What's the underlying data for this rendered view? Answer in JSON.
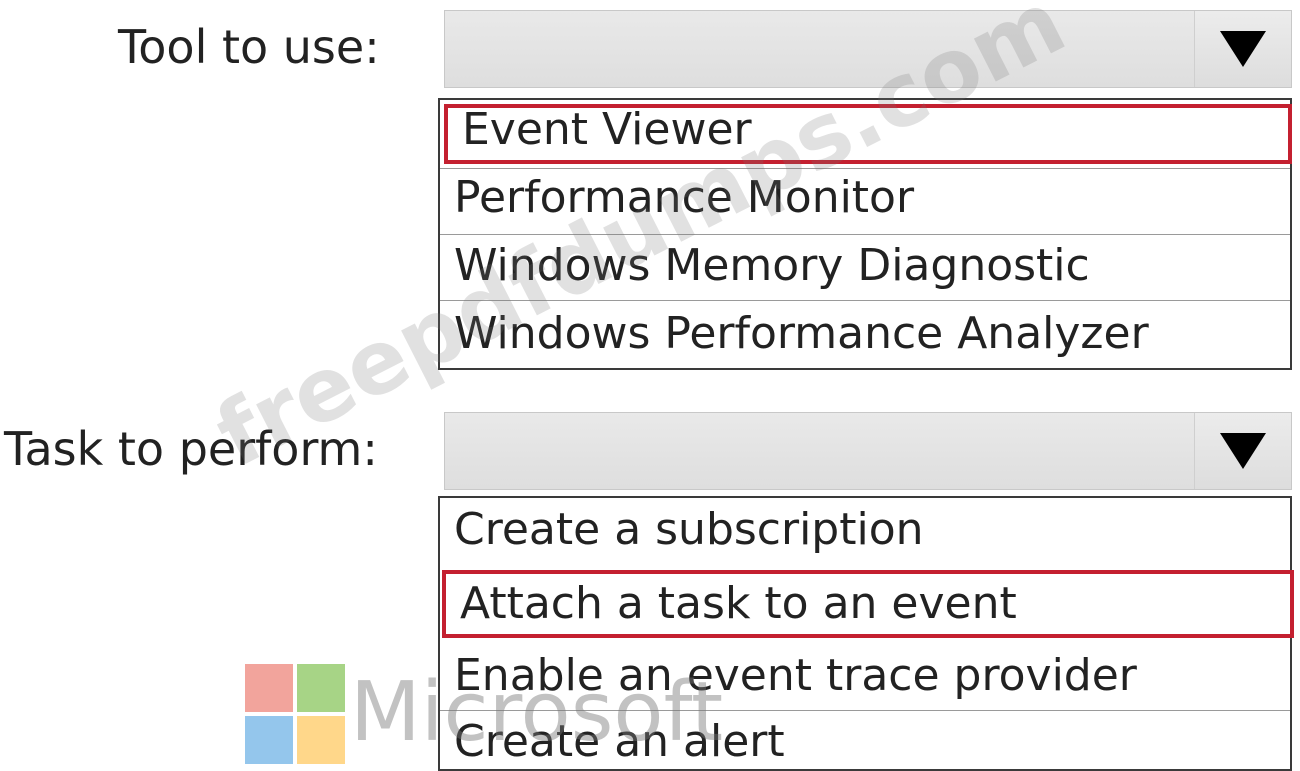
{
  "tool_section": {
    "label": "Tool to use:",
    "selected_value": "",
    "options": [
      {
        "label": "Event Viewer",
        "highlighted": true
      },
      {
        "label": "Performance Monitor",
        "highlighted": false
      },
      {
        "label": "Windows Memory Diagnostic",
        "highlighted": false
      },
      {
        "label": "Windows Performance Analyzer",
        "highlighted": false
      }
    ]
  },
  "task_section": {
    "label": "Task to perform:",
    "selected_value": "",
    "options": [
      {
        "label": "Create a subscription",
        "highlighted": false
      },
      {
        "label": "Attach a task to an event",
        "highlighted": true
      },
      {
        "label": "Enable an event trace provider",
        "highlighted": false
      },
      {
        "label": "Create an alert",
        "highlighted": false
      }
    ]
  },
  "watermark": {
    "text": "freepdfdumps.com"
  },
  "logo": {
    "text": "Microsoft"
  },
  "colors": {
    "highlight_border": "#c42030",
    "combo_background": "#e4e4e4",
    "list_border": "#3a3a3a"
  },
  "icons": {
    "dropdown_arrow": "triangle-down-icon"
  }
}
